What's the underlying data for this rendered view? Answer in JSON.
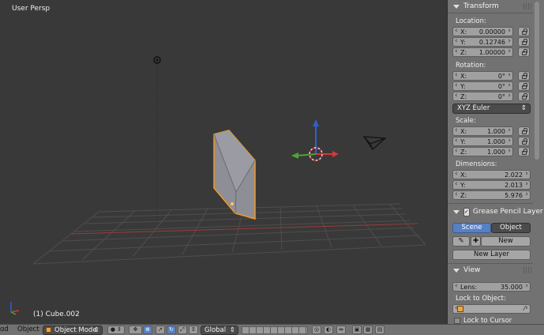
{
  "viewport": {
    "perspective_label": "User Persp",
    "object_label": "(1) Cube.002"
  },
  "panel": {
    "transform": {
      "title": "Transform",
      "location_label": "Location:",
      "location": [
        {
          "axis": "X:",
          "value": "0.00000"
        },
        {
          "axis": "Y:",
          "value": "0.12746"
        },
        {
          "axis": "Z:",
          "value": "1.00000"
        }
      ],
      "rotation_label": "Rotation:",
      "rotation": [
        {
          "axis": "X:",
          "value": "0°"
        },
        {
          "axis": "Y:",
          "value": "0°"
        },
        {
          "axis": "Z:",
          "value": "0°"
        }
      ],
      "rotation_mode": "XYZ Euler",
      "scale_label": "Scale:",
      "scale": [
        {
          "axis": "X:",
          "value": "1.000"
        },
        {
          "axis": "Y:",
          "value": "1.000"
        },
        {
          "axis": "Z:",
          "value": "1.000"
        }
      ],
      "dimensions_label": "Dimensions:",
      "dimensions": [
        {
          "axis": "X:",
          "value": "2.022"
        },
        {
          "axis": "Y:",
          "value": "2.013"
        },
        {
          "axis": "Z:",
          "value": "5.976"
        }
      ]
    },
    "grease": {
      "title": "Grease Pencil Layer",
      "scene_tab": "Scene",
      "object_tab": "Object",
      "new_label": "New",
      "new_layer_label": "New Layer"
    },
    "view": {
      "title": "View",
      "lens_label": "Lens:",
      "lens_value": "35.000",
      "lock_object_label": "Lock to Object:",
      "lock_cursor_label": "Lock to Cursor"
    }
  },
  "header": {
    "view_menu": "ɑd",
    "object_menu": "Object",
    "mode": "Object Mode",
    "orientation": "Global"
  },
  "colors": {
    "accent": "#5680c2",
    "selection_outline": "#f39a21",
    "axis_x": "#d8373a",
    "axis_y": "#4ca533",
    "axis_z": "#2f5fd6"
  }
}
